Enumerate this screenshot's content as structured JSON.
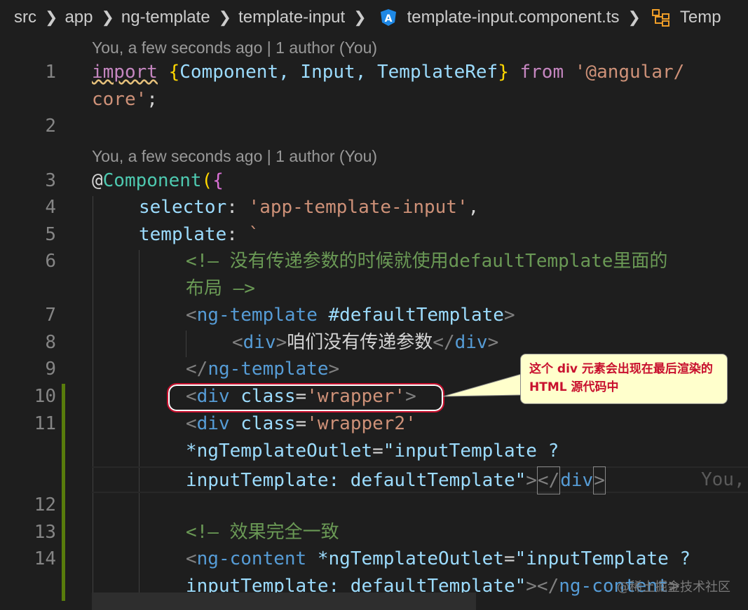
{
  "breadcrumb": {
    "items": [
      "src",
      "app",
      "ng-template",
      "template-input"
    ],
    "file": "template-input.component.ts",
    "symbol": "Temp"
  },
  "codelens": {
    "first": "You, a few seconds ago | 1 author (You)",
    "second": "You, a few seconds ago | 1 author (You)"
  },
  "line_numbers": [
    "1",
    "2",
    "3",
    "4",
    "5",
    "6",
    "7",
    "8",
    "9",
    "10",
    "11",
    "12",
    "13",
    "14"
  ],
  "code": {
    "l1a": {
      "kw": "import",
      "brace_open": "{",
      "names": "Component, Input, TemplateRef",
      "brace_close": "}",
      "from": "from",
      "str": "'@angular/"
    },
    "l1b": {
      "str": "core'",
      "semi": ";"
    },
    "l3": {
      "at": "@",
      "fn": "Component",
      "open": "(",
      "brace": "{"
    },
    "l4": {
      "prop": "selector",
      "colon": ": ",
      "str": "'app-template-input'",
      "comma": ","
    },
    "l5": {
      "prop": "template",
      "colon": ": ",
      "tick": "`"
    },
    "l6a": "<!— 没有传递参数的时候就使用defaultTemplate里面的",
    "l6b": "布局 —>",
    "l7": {
      "lt": "<",
      "tag": "ng-template",
      "attr": " #defaultTemplate",
      "gt": ">"
    },
    "l8": {
      "lt": "<",
      "tag": "div",
      "gt": ">",
      "text": "咱们没有传递参数",
      "lt2": "</",
      "tag2": "div",
      "gt2": ">"
    },
    "l9": {
      "lt": "</",
      "tag": "ng-template",
      "gt": ">"
    },
    "l10": {
      "lt": "<",
      "tag": "div",
      "attr": " class",
      "eq": "=",
      "val": "'wrapper'",
      "gt": ">"
    },
    "l11a": {
      "lt": "<",
      "tag": "div",
      "attr": " class",
      "eq": "=",
      "val": "'wrapper2'"
    },
    "l11b": {
      "attr": "*ngTemplateOutlet",
      "eq": "=",
      "val": "\"inputTemplate ?"
    },
    "l11c": {
      "val": "inputTemplate: defaultTemplate\"",
      "gt": ">",
      "lt2": "</",
      "tag2": "div",
      "gt2": ">"
    },
    "l13": "<!— 效果完全一致",
    "l14a": {
      "lt": "<",
      "tag": "ng-content",
      "attr": " *ngTemplateOutlet",
      "eq": "=",
      "val": "\"inputTemplate ?"
    },
    "l14b": {
      "val": "inputTemplate: defaultTemplate\"",
      "gt": ">",
      "lt2": "</",
      "tag2": "ng-content",
      "gt2": ">"
    }
  },
  "ghost_blame": "You,",
  "callout": {
    "text": "这个 div 元素会出现在最后渲染的 HTML 源代码中"
  },
  "watermark": "@稀土掘金技术社区",
  "colors": {
    "background": "#1e1e1e",
    "keyword": "#c586c0",
    "string": "#ce9178",
    "tag": "#569cd6",
    "comment": "#6a9955",
    "callout_bg": "#ffffcc",
    "callout_text": "#c8102e",
    "gutter_modified": "#587c0c"
  }
}
